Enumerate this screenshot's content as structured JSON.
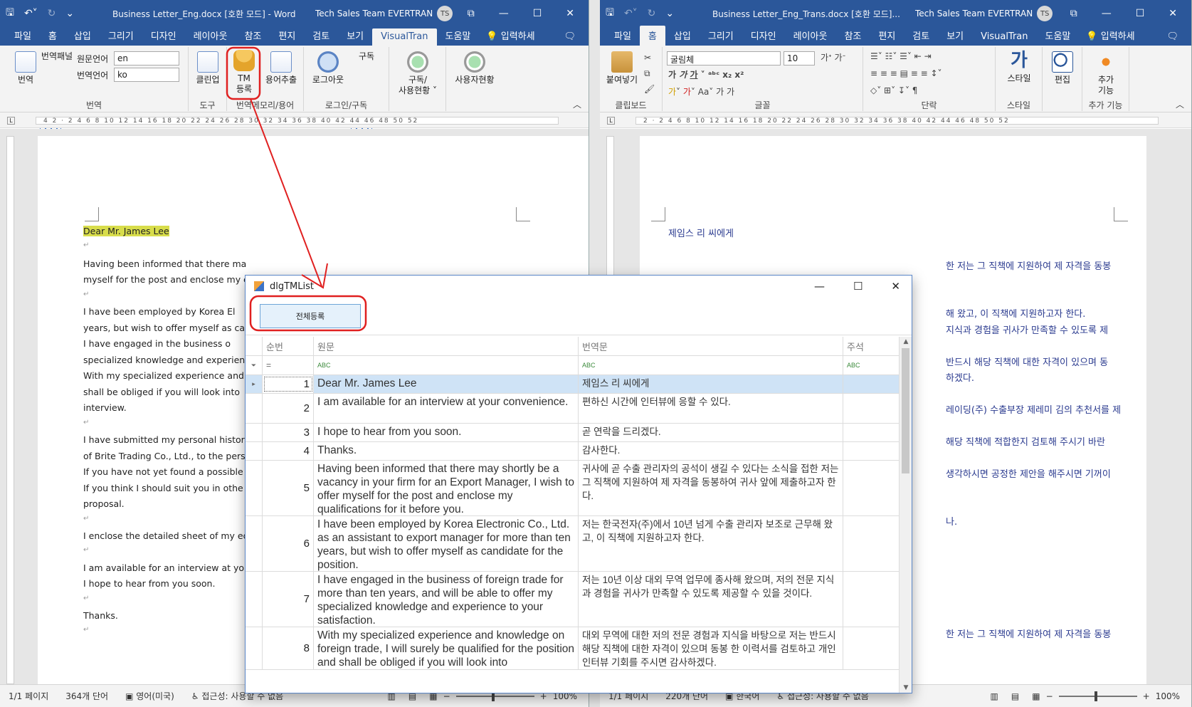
{
  "left_window": {
    "title": "Business Letter_Eng.docx [호환 모드]  -  Word",
    "user": "Tech Sales Team EVERTRAN",
    "avatar": "TS",
    "tabs": [
      "파일",
      "홈",
      "삽입",
      "그리기",
      "디자인",
      "레이아웃",
      "참조",
      "편지",
      "검토",
      "보기",
      "VisualTran",
      "도움말"
    ],
    "tell_me": "입력하세",
    "ribbon": {
      "translate_btn": "번역",
      "panel_btn": "번역패널",
      "src_lang_label": "원문언어",
      "src_lang_value": "en",
      "tgt_lang_label": "번역언어",
      "tgt_lang_value": "ko",
      "group_translate": "번역",
      "cleanup_btn": "클린업",
      "group_tools": "도구",
      "tm_btn_line1": "TM",
      "tm_btn_line2": "등록",
      "term_btn": "용어추출",
      "group_memory": "번역메모리/용어",
      "logout_btn": "로그아웃",
      "subscribe_btn": "구독",
      "group_login": "로그인/구독",
      "usage_btn_line1": "구독/",
      "usage_btn_line2": "사용현황 ˅",
      "user_usage_btn": "사용자현황"
    },
    "ruler": "4  2  ·  2  4  6  8  10  12  14  16  18  20  22  24  26  28  30  32  34  36  38  40  42  44  46  48  50  52",
    "doc_lines": [
      "Dear Mr. James Lee",
      "Having been informed that there ma",
      "myself for the post and enclose my c",
      "I have been employed by Korea El",
      "years, but wish to offer myself as car",
      "I have engaged in the business o",
      "specialized knowledge and experien",
      "With my specialized experience and",
      "shall be obliged if you will look into",
      "interview.",
      "I have submitted my personal histor",
      "of Brite Trading Co., Ltd., to the pers",
      "If you have not yet found a possible",
      "If you think I should suit you in othe",
      "proposal.",
      "I enclose the detailed sheet of my ed",
      "I am available for an interview at you",
      "I hope to hear from you soon.",
      "Thanks."
    ],
    "status": {
      "page": "1/1 페이지",
      "words": "364개 단어",
      "lang": "영어(미국)",
      "access": "접근성: 사용할 수 없음",
      "zoom": "100%"
    }
  },
  "right_window": {
    "title": "Business Letter_Eng_Trans.docx [호환 모드]...",
    "user": "Tech Sales Team EVERTRAN",
    "avatar": "TS",
    "tabs": [
      "파일",
      "홈",
      "삽입",
      "그리기",
      "디자인",
      "레이아웃",
      "참조",
      "편지",
      "검토",
      "보기",
      "VisualTran",
      "도움말"
    ],
    "tell_me": "입력하세",
    "ribbon": {
      "paste_btn": "붙여넣기",
      "group_clipboard": "클립보드",
      "font_name": "굴림체",
      "font_size": "10",
      "group_font": "글꼴",
      "group_paragraph": "단락",
      "style_btn": "스타일",
      "group_style": "스타일",
      "edit_btn": "편집",
      "addin_line1": "추가",
      "addin_line2": "기능",
      "group_addin": "추가 기능"
    },
    "ruler": "2  ·  2  4  6  8  10  12  14  16  18  20  22  24  26  28  30  32  34  36  38  40  42  44  46  48  50  52",
    "doc_lines": [
      "제임스 리 씨에게",
      "한 저는 그 직책에 지원하여 제 자격을 동봉",
      "해 왔고, 이 직책에 지원하고자 한다.",
      "지식과 경험을 귀사가 만족할 수 있도록 제",
      "반드시 해당 직책에 대한 자격이 있으며 동",
      "하겠다.",
      "레이딩(주) 수출부장 제레미 김의 추천서를 제",
      "해당 직책에 적합한지 검토해 주시기 바란",
      "생각하시면 공정한 제안을 해주시면 기꺼이",
      "나.",
      "한 저는 그 직책에 지원하여 제 자격을 동봉"
    ],
    "status": {
      "page": "1/1 페이지",
      "words": "220개 단어",
      "lang": "한국어",
      "access": "접근성: 사용할 수 없음",
      "zoom": "100%"
    }
  },
  "dialog": {
    "title": "dlgTMList",
    "register_all_btn": "전체등록",
    "columns": {
      "no": "순번",
      "source": "원문",
      "target": "번역문",
      "note": "주석"
    },
    "filter_eq": "=",
    "filter_abc": "ABC",
    "rows": [
      {
        "no": "1",
        "source": "Dear Mr. James Lee",
        "target": "제임스 리 씨에게",
        "note": ""
      },
      {
        "no": "2",
        "source": "I am available for an interview at your convenience.",
        "target": "편하신 시간에 인터뷰에 응할 수 있다.",
        "note": ""
      },
      {
        "no": "3",
        "source": "I hope to hear from you soon.",
        "target": "곧 연락을 드리겠다.",
        "note": ""
      },
      {
        "no": "4",
        "source": "Thanks.",
        "target": "감사한다.",
        "note": ""
      },
      {
        "no": "5",
        "source": "Having been informed that there may shortly be a vacancy in your firm for an Export Manager, I wish to offer myself for the post and enclose my qualifications for it before you.",
        "target": "귀사에 곧 수출 관리자의 공석이 생길 수 있다는 소식을 접한 저는 그 직책에 지원하여 제 자격을 동봉하여 귀사 앞에 제출하고자 한다.",
        "note": ""
      },
      {
        "no": "6",
        "source": "I have been employed by Korea Electronic Co., Ltd. as an assistant to export manager for more than ten years, but wish to offer myself as candidate for the position.",
        "target": "저는 한국전자(주)에서 10년 넘게 수출 관리자 보조로 근무해 왔고, 이 직책에 지원하고자 한다.",
        "note": ""
      },
      {
        "no": "7",
        "source": "I have engaged in the business of foreign trade for more than ten years, and will be able to offer my specialized knowledge and experience to your satisfaction.",
        "target": "저는 10년 이상 대외 무역 업무에 종사해 왔으며, 저의 전문 지식과 경험을 귀사가 만족할 수 있도록 제공할 수 있을 것이다.",
        "note": ""
      },
      {
        "no": "8",
        "source": "With my specialized experience and knowledge on foreign trade, I will surely be qualified for the position and shall be obliged if you will look into",
        "target": "대외 무역에 대한 저의 전문 경험과 지식을 바탕으로 저는 반드시 해당 직책에 대한 자격이 있으며 동봉 한 이력서를 검토하고 개인 인터뷰 기회를 주시면 감사하겠다.",
        "note": ""
      }
    ]
  },
  "annotation_color": "#e02020",
  "brand_color": "#2b579a"
}
